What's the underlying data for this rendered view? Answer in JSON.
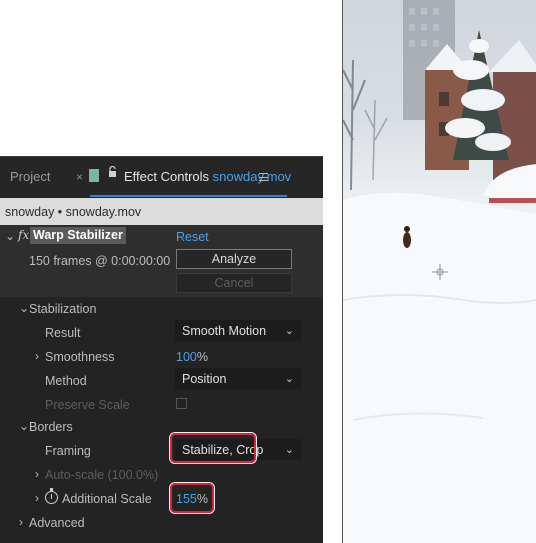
{
  "tabs": {
    "project": "Project",
    "close_glyph": "×",
    "effect_controls": "Effect Controls",
    "file": "snowday.mov",
    "menu_icon": "hamburger-menu-icon"
  },
  "subheader": "snowday • snowday.mov",
  "effect": {
    "fx_glyph": "fx",
    "name": "Warp Stabilizer",
    "reset": "Reset",
    "frames_info": "150 frames @ 0:00:00:00",
    "analyze": "Analyze",
    "cancel": "Cancel"
  },
  "stabilization": {
    "section": "Stabilization",
    "result_label": "Result",
    "result_value": "Smooth Motion",
    "smoothness_label": "Smoothness",
    "smoothness_value": "100",
    "smoothness_unit": "%",
    "method_label": "Method",
    "method_value": "Position",
    "preserve_scale_label": "Preserve Scale"
  },
  "borders": {
    "section": "Borders",
    "framing_label": "Framing",
    "framing_value": "Stabilize, Crop",
    "autoscale_label": "Auto-scale (100.0%)",
    "additional_scale_label": "Additional Scale",
    "additional_scale_value": "155",
    "additional_scale_unit": "%"
  },
  "advanced": "Advanced",
  "colors": {
    "panel_bg": "#232323",
    "accent_blue": "#4c9fe6",
    "highlight_red": "#d6283a"
  }
}
